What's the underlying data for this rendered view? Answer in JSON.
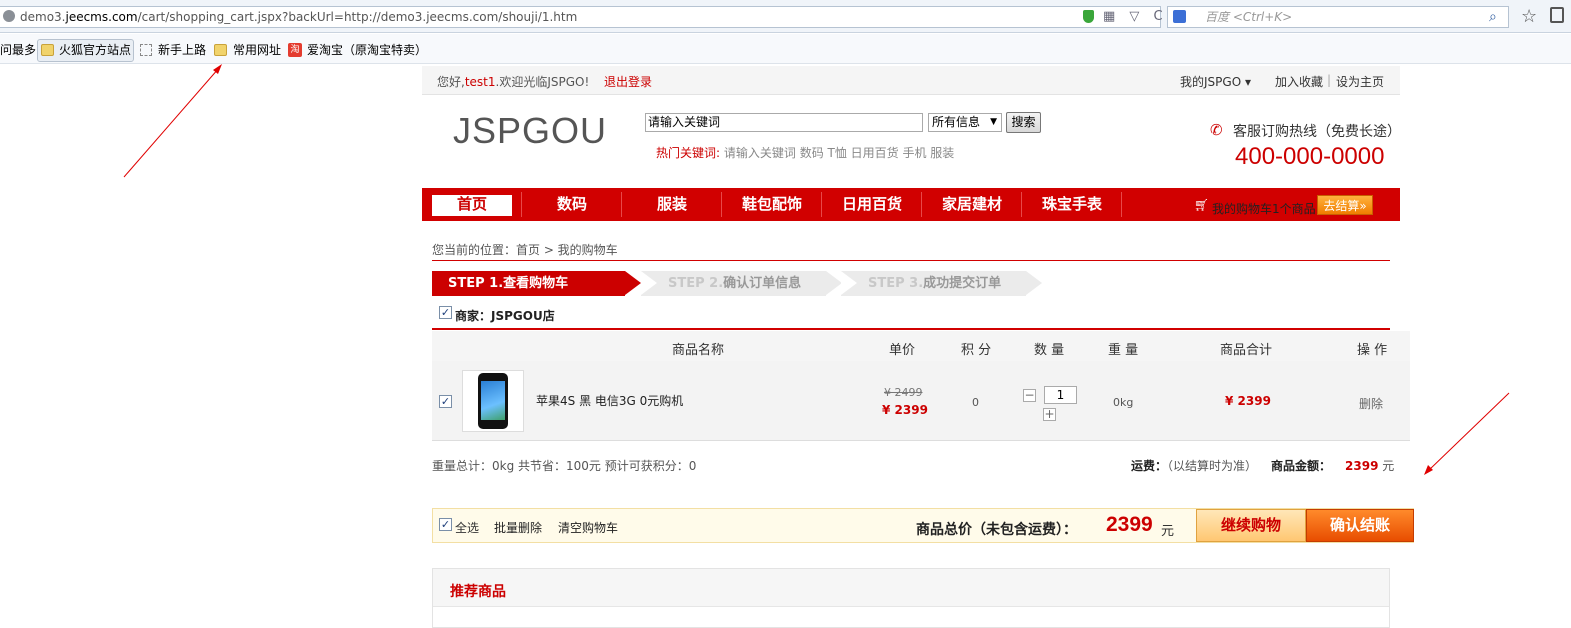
{
  "browser": {
    "url_prefix": "demo3.",
    "url_domain": "jeecms.com",
    "url_rest": "/cart/shopping_cart.jspx?backUrl=http://demo3.jeecms.com/shouji/1.htm",
    "search_placeholder": "百度 <Ctrl+K>",
    "url_icons": "▦ ▽ C",
    "bookmarks": {
      "most_visited": "问最多",
      "official": "火狐官方站点",
      "getting_started": "新手上路",
      "common": "常用网址",
      "taobao_icon_text": "淘",
      "taobao": "爱淘宝（原淘宝特卖）"
    }
  },
  "topbar": {
    "greeting_pre": "您好,",
    "username": "test1",
    "greeting_post": ".欢迎光临JSPGO!",
    "logout": "退出登录",
    "my_jspgo": "我的JSPGO ▾",
    "add_favorite": "加入收藏",
    "sep": "|",
    "set_home": "设为主页"
  },
  "header": {
    "logo": "JSPGOU",
    "search_value": "请输入关键词",
    "search_select": "所有信息",
    "search_button": "搜索",
    "hot_label": "热门关键词:",
    "hot_keywords": "请输入关键词  数码  T恤  日用百货  手机  服装",
    "hotline_label": "客服订购热线（免费长途）",
    "hotline_number": "400-000-0000"
  },
  "nav": {
    "items": [
      "首页",
      "数码",
      "服装",
      "鞋包配饰",
      "日用百货",
      "家居建材",
      "珠宝手表"
    ],
    "cart_text": "我的购物车1个商品",
    "checkout": "去结算»"
  },
  "breadcrumb": "您当前的位置：首页 > 我的购物车",
  "steps": [
    {
      "num": "STEP 1.",
      "label": "查看购物车"
    },
    {
      "num": "STEP 2.",
      "label": "确认订单信息"
    },
    {
      "num": "STEP 3.",
      "label": "成功提交订单"
    }
  ],
  "merchant": "商家：JSPGOU店",
  "table": {
    "headers": [
      "商品名称",
      "单价",
      "积 分",
      "数 量",
      "重 量",
      "商品合计",
      "操 作"
    ],
    "row": {
      "name": "苹果4S  黑 电信3G 0元购机",
      "old_price": "¥ 2499",
      "price": "¥ 2399",
      "points": "0",
      "qty_minus": "−",
      "quantity": "1",
      "qty_plus": "+",
      "weight": "0kg",
      "subtotal": "¥ 2399",
      "delete": "删除"
    }
  },
  "summary": {
    "weight_total": "重量总计：0kg   共节省：100元   预计可获积分：0",
    "shipping_label": "运费：",
    "shipping_value": "（以结算时为准）",
    "amount_label": "商品金额：",
    "amount_value": "2399",
    "amount_unit": " 元"
  },
  "bottom": {
    "select_all": "全选",
    "batch_delete": "批量删除",
    "clear_cart": "清空购物车",
    "total_label": "商品总价（未包含运费）：",
    "total_value": "2399",
    "total_unit": "元",
    "continue": "继续购物",
    "confirm": "确认结账"
  },
  "recommend": "推荐商品",
  "colors": {
    "brand_red": "#d10000",
    "price_red": "#cc0000",
    "annotation_red": "#e00000"
  }
}
